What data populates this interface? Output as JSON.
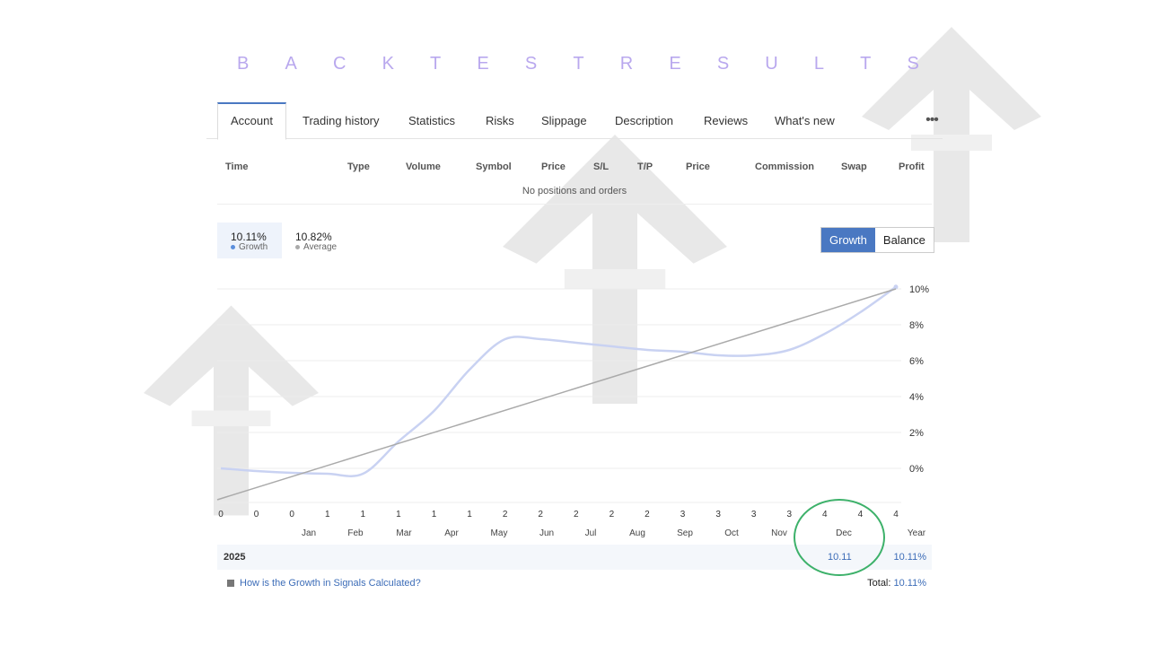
{
  "title_letters": [
    "B",
    "A",
    "C",
    "K",
    "T",
    "E",
    "S",
    "T",
    "R",
    "E",
    "S",
    "U",
    "L",
    "T",
    "S"
  ],
  "tabs": [
    "Account",
    "Trading history",
    "Statistics",
    "Risks",
    "Slippage",
    "Description",
    "Reviews",
    "What's new"
  ],
  "table": {
    "headers": [
      "Time",
      "Type",
      "Volume",
      "Symbol",
      "Price",
      "S/L",
      "T/P",
      "Price",
      "Commission",
      "Swap",
      "Profit"
    ],
    "empty_text": "No positions and orders"
  },
  "stats": {
    "growth_value": "10.11%",
    "growth_label": "Growth",
    "average_value": "10.82%",
    "average_label": "Average"
  },
  "toggle": {
    "growth": "Growth",
    "balance": "Balance"
  },
  "chart_data": {
    "type": "line",
    "y_ticks": [
      "10%",
      "8%",
      "6%",
      "4%",
      "2%",
      "0%"
    ],
    "ylim": [
      -1.8,
      10
    ],
    "x_count_labels": [
      "0",
      "0",
      "0",
      "1",
      "1",
      "1",
      "1",
      "1",
      "2",
      "2",
      "2",
      "2",
      "2",
      "3",
      "3",
      "3",
      "3",
      "4",
      "4",
      "4"
    ],
    "series": [
      {
        "name": "Growth",
        "color": "#c9d2f2",
        "x": [
          0,
          1,
          2,
          3,
          4,
          5,
          6,
          7,
          8,
          9,
          10,
          11,
          12,
          13,
          14,
          15,
          16,
          17,
          18,
          19
        ],
        "values": [
          0.0,
          -0.15,
          -0.25,
          -0.3,
          -0.3,
          1.5,
          3.2,
          5.5,
          7.2,
          7.2,
          7.0,
          6.8,
          6.6,
          6.5,
          6.3,
          6.3,
          6.6,
          7.5,
          8.7,
          10.11
        ]
      },
      {
        "name": "Average",
        "color": "#aaaaaa",
        "x": [
          0,
          19
        ],
        "values": [
          -0.8,
          10.0
        ]
      }
    ]
  },
  "months": [
    "Jan",
    "Feb",
    "Mar",
    "Apr",
    "May",
    "Jun",
    "Jul",
    "Aug",
    "Sep",
    "Oct",
    "Nov",
    "Dec",
    "Year"
  ],
  "year_row": {
    "year": "2025",
    "dec_value": "10.11",
    "year_value": "10.11%"
  },
  "help_link": "How is the Growth in Signals Calculated?",
  "total": {
    "label": "Total:",
    "value": "10.11%"
  },
  "colors": {
    "accent": "#4a78c2",
    "link": "#3d6db8",
    "highlight_circle": "#3db16a"
  }
}
